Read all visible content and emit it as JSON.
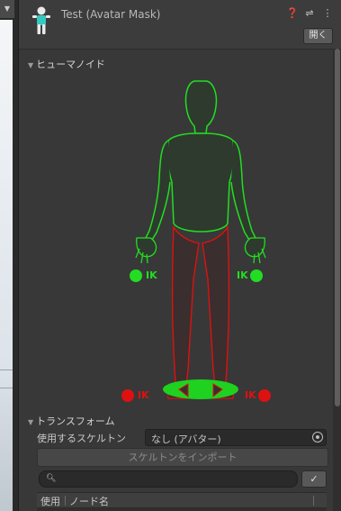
{
  "header": {
    "title": "Test (Avatar Mask)",
    "open_label": "開く",
    "icons": [
      "help-icon",
      "settings-sliders-icon",
      "kebab-menu-icon"
    ]
  },
  "humanoid": {
    "section_label": "ヒューマノイド",
    "ik_left_hand": "IK",
    "ik_right_hand": "IK",
    "ik_left_foot": "IK",
    "ik_right_foot": "IK",
    "colors": {
      "enabled": "#22dd22",
      "disabled": "#dd1111"
    }
  },
  "transform": {
    "section_label": "トランスフォーム",
    "skeleton_label": "使用するスケルトン",
    "skeleton_value": "なし (アバター)",
    "import_button": "スケルトンをインポート",
    "search_placeholder": "",
    "check_label": "✓",
    "columns": [
      "使用",
      "ノード名"
    ]
  }
}
